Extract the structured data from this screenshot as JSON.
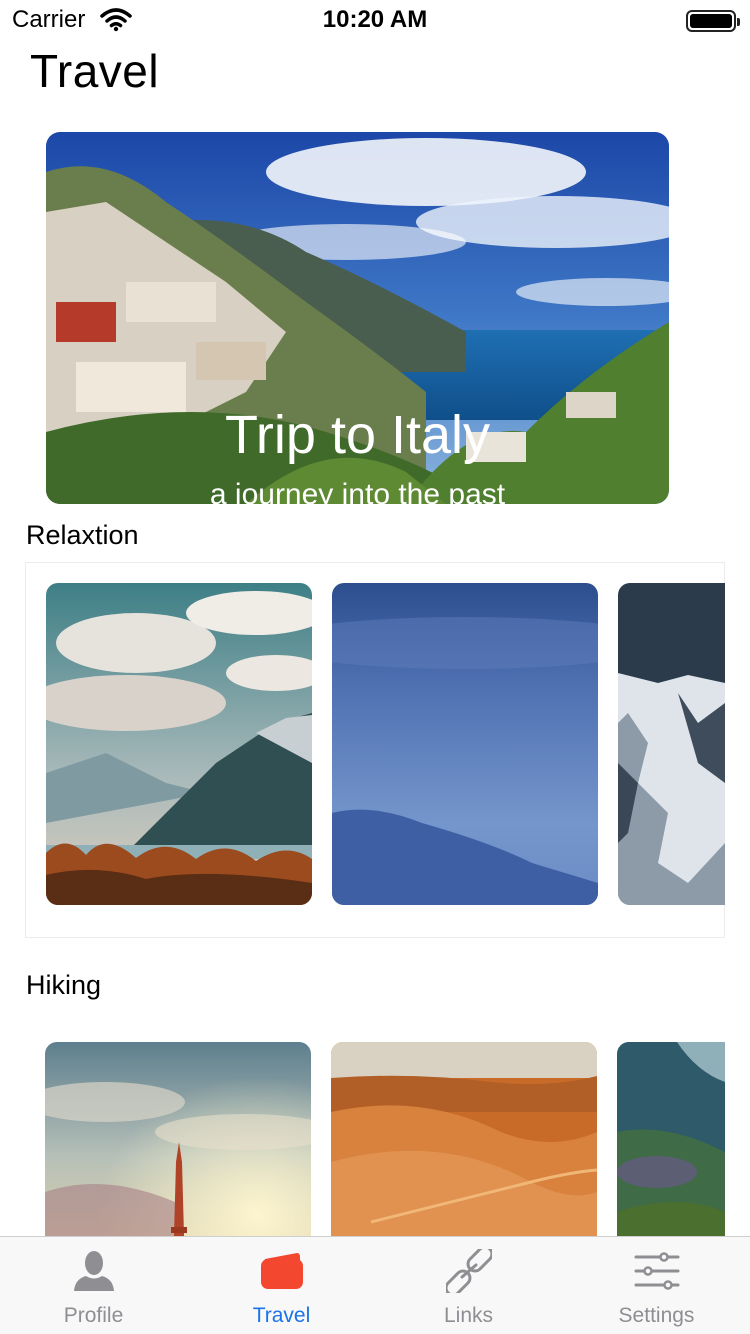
{
  "status_bar": {
    "carrier": "Carrier",
    "time": "10:20 AM"
  },
  "page": {
    "title": "Travel"
  },
  "hero": {
    "title": "Trip to Italy",
    "subtitle": "a journey into the past"
  },
  "sections": {
    "relaxation": {
      "title": "Relaxtion"
    },
    "hiking": {
      "title": "Hiking"
    }
  },
  "tab_bar": {
    "items": [
      {
        "label": "Profile",
        "icon": "person-icon"
      },
      {
        "label": "Travel",
        "icon": "wallet-icon"
      },
      {
        "label": "Links",
        "icon": "link-icon"
      },
      {
        "label": "Settings",
        "icon": "sliders-icon"
      }
    ],
    "selected": "Travel",
    "accent": "#1a73e8",
    "selected_icon_color": "#f4472f"
  }
}
